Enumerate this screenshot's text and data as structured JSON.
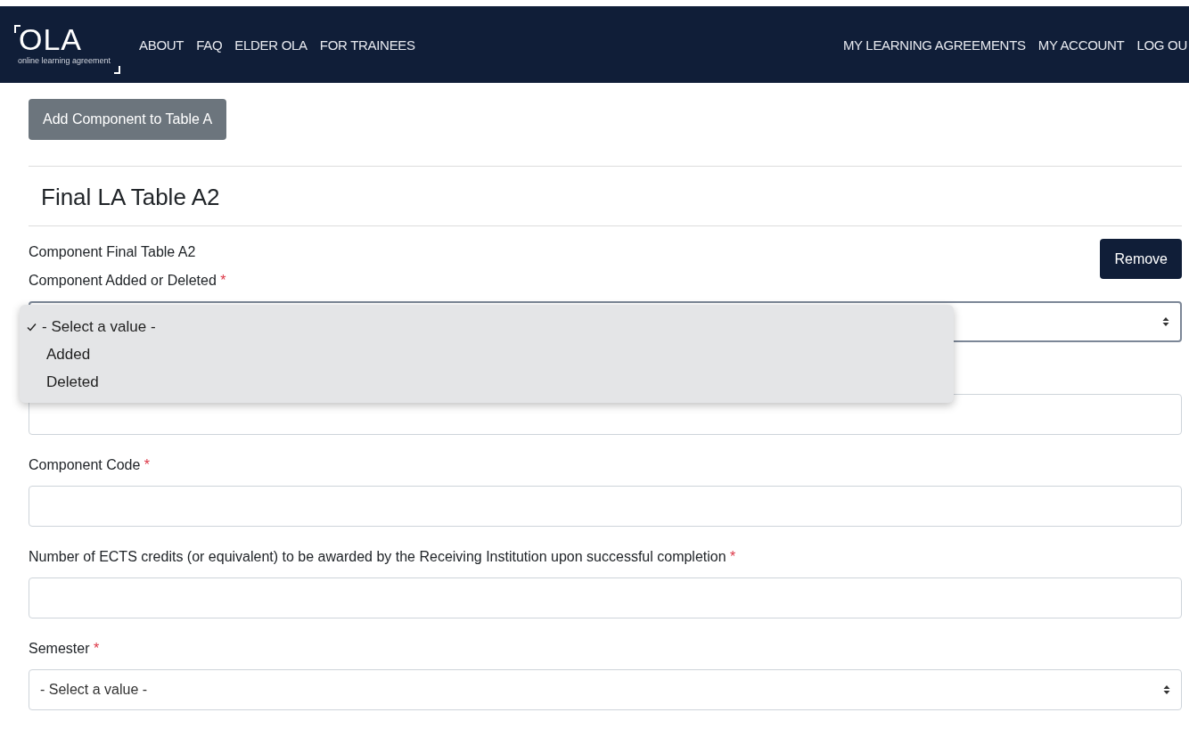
{
  "nav": {
    "logo": "OLA",
    "logo_subtitle": "online learning agreement",
    "left_links": [
      "ABOUT",
      "FAQ",
      "ELDER OLA",
      "FOR TRAINEES"
    ],
    "right_links": [
      "MY LEARNING AGREEMENTS",
      "MY ACCOUNT",
      "LOG OU"
    ]
  },
  "add_button": "Add Component to Table A",
  "section_title": "Final LA Table A2",
  "component": {
    "title": "Component Final Table A2",
    "remove_button": "Remove",
    "fields": [
      {
        "kind": "select",
        "label": "Component Added or Deleted",
        "required_mark": "*",
        "open": true,
        "options": [
          {
            "label": "- Select a value -",
            "selected": true
          },
          {
            "label": "Added",
            "selected": false
          },
          {
            "label": "Deleted",
            "selected": false
          }
        ]
      },
      {
        "kind": "text"
      },
      {
        "kind": "text",
        "label": "Component Code",
        "required_mark": "*"
      },
      {
        "kind": "text",
        "label": "Number of ECTS credits (or equivalent) to be awarded by the Receiving Institution upon successful completion",
        "required_mark": "*"
      },
      {
        "kind": "select",
        "label": "Semester",
        "required_mark": "*",
        "value": "- Select a value -"
      }
    ]
  }
}
